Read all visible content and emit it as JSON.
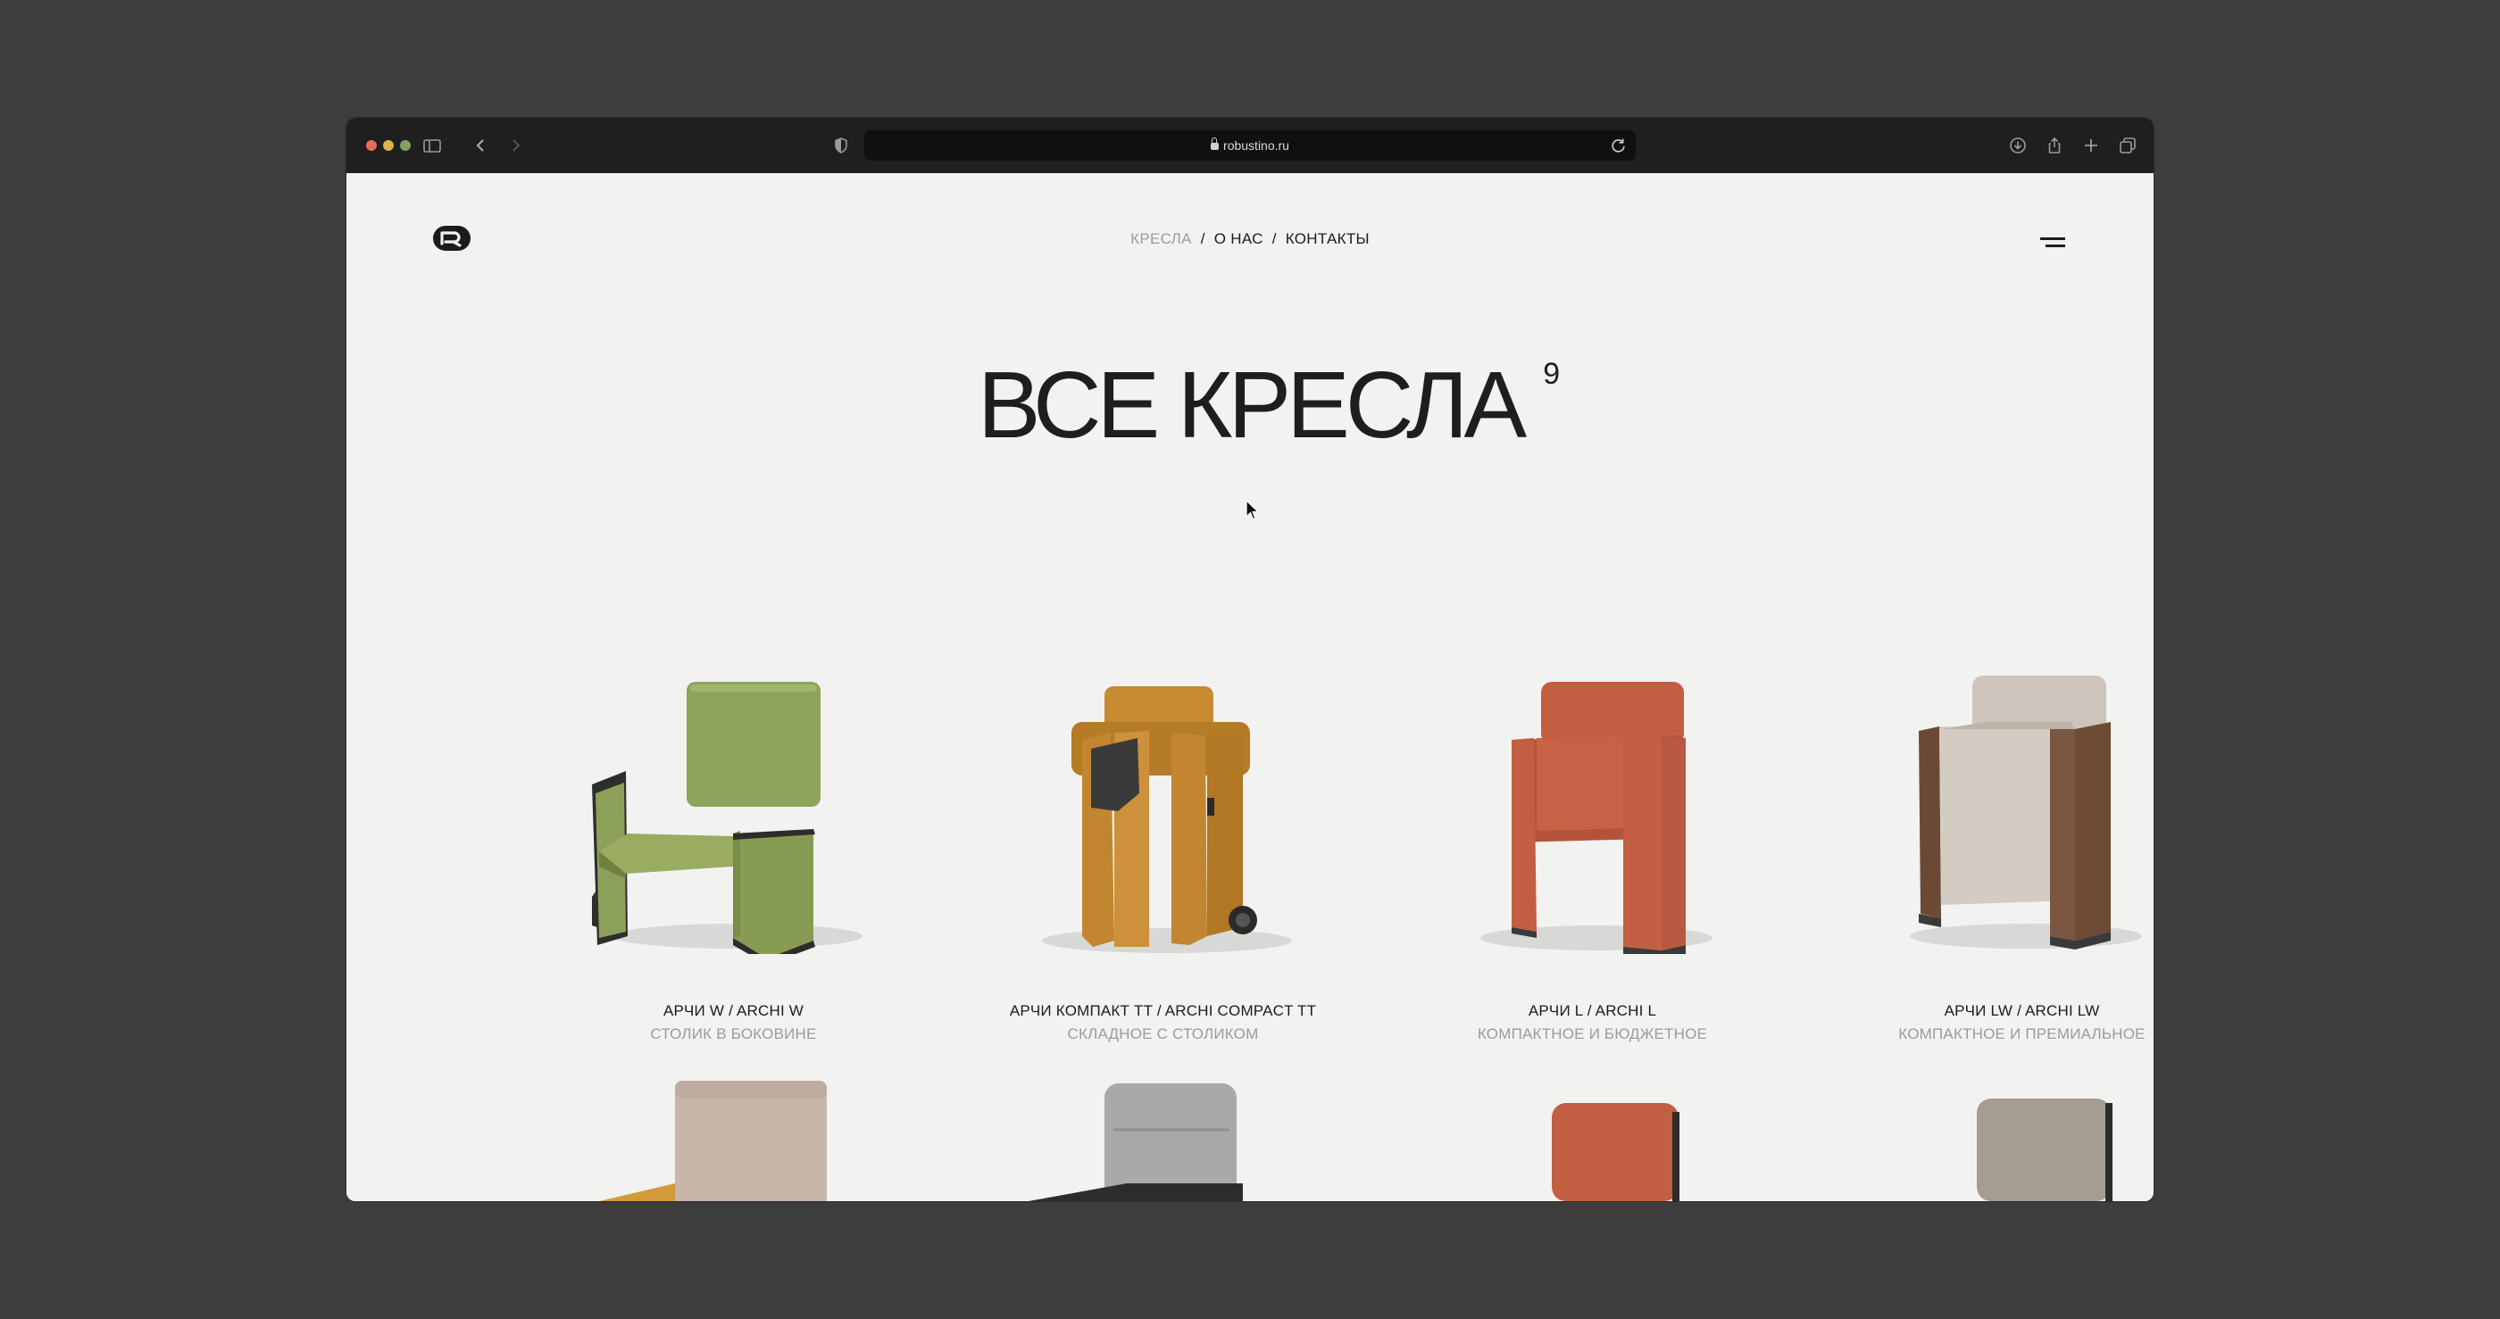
{
  "browser": {
    "url": "robustino.ru"
  },
  "nav": {
    "items": [
      "КРЕСЛА",
      "О НАС",
      "КОНТАКТЫ"
    ],
    "separator": "/"
  },
  "hero": {
    "title": "ВСЕ КРЕСЛА",
    "count": "9"
  },
  "products": [
    {
      "name": "АРЧИ W / ARCHI W",
      "subtitle": "СТОЛИК В БОКОВИНЕ",
      "color": "#8da05a"
    },
    {
      "name": "АРЧИ КОМПАКТ TT / ARCHI COMPACT TT",
      "subtitle": "СКЛАДНОЕ С СТОЛИКОМ",
      "color": "#c1862f"
    },
    {
      "name": "АРЧИ L / ARCHI L",
      "subtitle": "КОМПАКТНОЕ И БЮДЖЕТНОЕ",
      "color": "#c25e42"
    },
    {
      "name": "АРЧИ LW / ARCHI LW",
      "subtitle": "КОМПАКТНОЕ И ПРЕМИАЛЬНОЕ",
      "color": "#cfc6bc"
    }
  ],
  "colors": {
    "page_bg": "#f2f2f0",
    "desktop_bg": "#3d3d3d",
    "text": "#1b1b1b",
    "muted": "#9b9b9b"
  }
}
